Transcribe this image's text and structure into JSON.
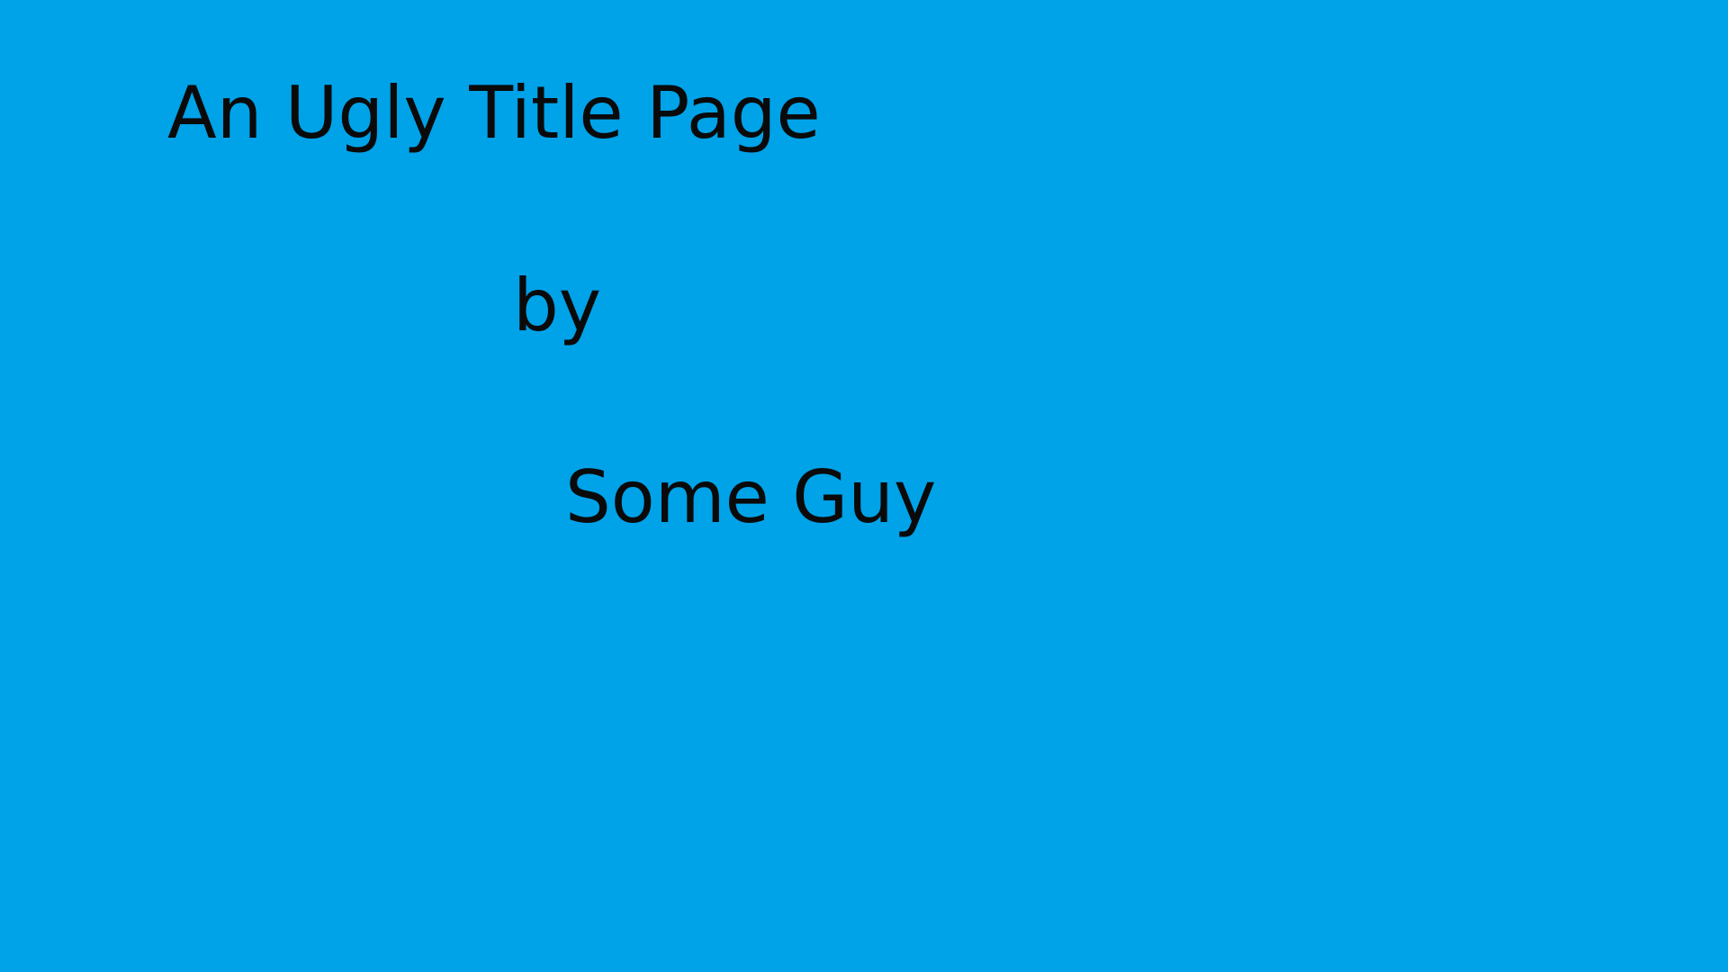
{
  "slide": {
    "title": "An Ugly Title Page",
    "by": "by",
    "author": "Some Guy"
  },
  "colors": {
    "background": "#00A2E8",
    "text": "#0a0a0a"
  }
}
